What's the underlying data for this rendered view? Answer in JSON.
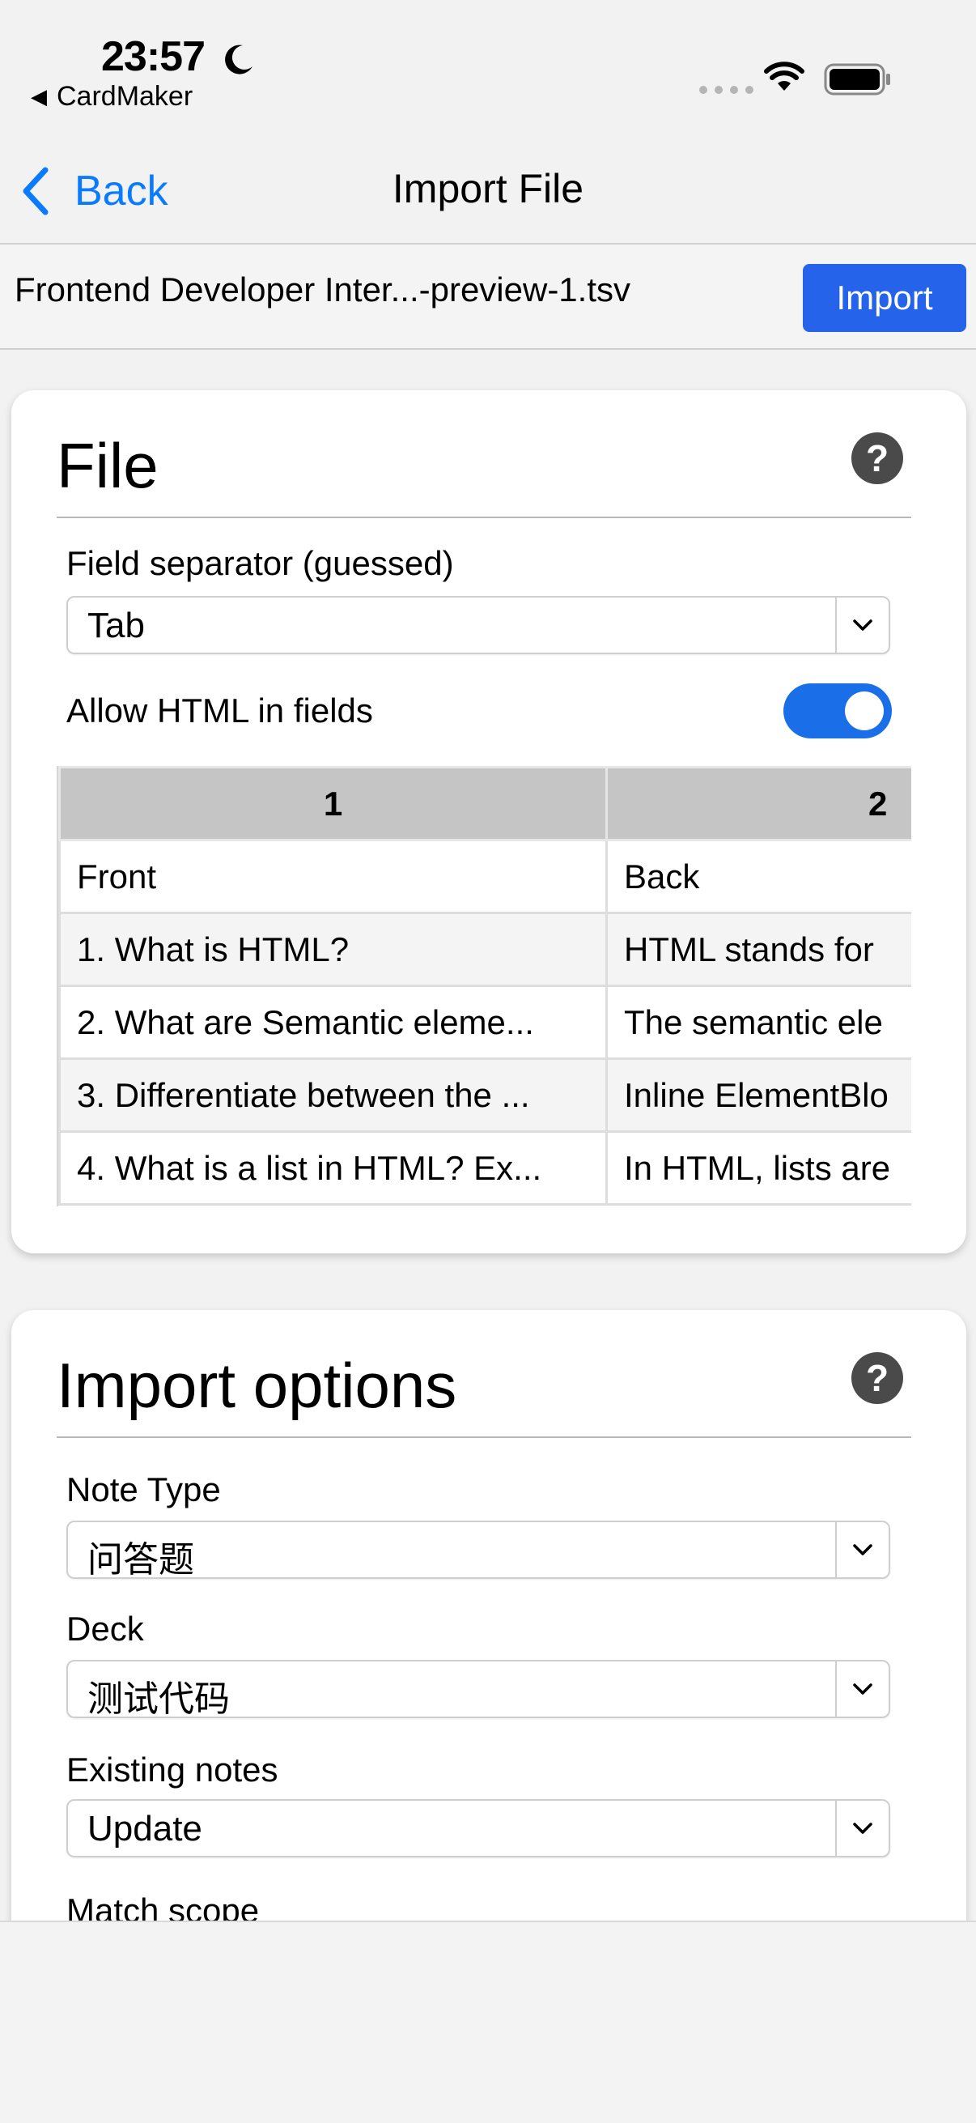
{
  "status_bar": {
    "time": "23:57",
    "back_app": "CardMaker"
  },
  "nav": {
    "back_label": "Back",
    "title": "Import File"
  },
  "file_bar": {
    "file_name": "Frontend Developer Inter...-preview-1.tsv",
    "import_label": "Import"
  },
  "file_section": {
    "title": "File",
    "separator_label": "Field separator (guessed)",
    "separator_value": "Tab",
    "allow_html_label": "Allow HTML in fields",
    "allow_html_on": true,
    "table": {
      "headers": [
        "1",
        "2"
      ],
      "rows": [
        [
          "Front",
          "Back"
        ],
        [
          "1. What is HTML?",
          "HTML stands for"
        ],
        [
          "2. What are Semantic eleme...",
          "The semantic ele"
        ],
        [
          "3. Differentiate between the ...",
          "Inline ElementBlo"
        ],
        [
          "4. What is a list in HTML? Ex...",
          "In HTML, lists are"
        ]
      ]
    }
  },
  "options_section": {
    "title": "Import options",
    "note_type_label": "Note Type",
    "note_type_value": "问答题",
    "deck_label": "Deck",
    "deck_value": "测试代码",
    "existing_label": "Existing notes",
    "existing_value": "Update",
    "match_scope_label": "Match scope"
  },
  "colors": {
    "accent": "#0a7aff",
    "import_button": "#2563eb",
    "toggle_on": "#1a6fe8"
  }
}
